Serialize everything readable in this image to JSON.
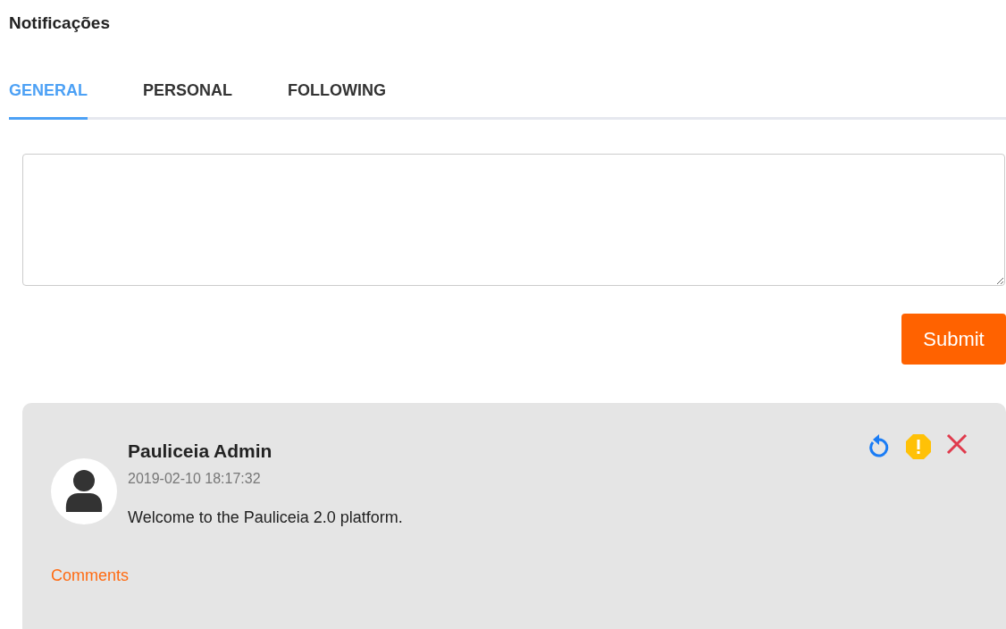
{
  "title": "Notificações",
  "tabs": [
    {
      "label": "GENERAL",
      "selected": true
    },
    {
      "label": "PERSONAL",
      "selected": false
    },
    {
      "label": "FOLLOWING",
      "selected": false
    }
  ],
  "composer": {
    "submit": "Submit"
  },
  "posts": [
    {
      "author": "Pauliceia Admin",
      "time": "2019-02-10 18:17:32",
      "text": "Welcome to the Pauliceia 2.0 platform.",
      "comments": "Comments"
    }
  ]
}
